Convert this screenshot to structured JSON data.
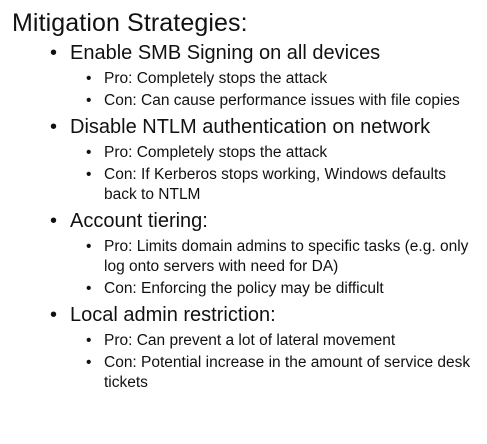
{
  "title": "Mitigation Strategies:",
  "bullet_glyph": "•",
  "strategies": [
    {
      "label": "Enable SMB Signing on all devices",
      "points": [
        "Pro: Completely stops the attack",
        "Con: Can cause performance issues with file copies"
      ]
    },
    {
      "label": "Disable NTLM authentication on network",
      "points": [
        "Pro: Completely stops the attack",
        "Con: If Kerberos stops working, Windows defaults back to NTLM"
      ]
    },
    {
      "label": "Account tiering:",
      "points": [
        "Pro: Limits domain admins to specific tasks (e.g. only log onto servers with need for DA)",
        "Con: Enforcing the policy may be difficult"
      ]
    },
    {
      "label": "Local admin restriction:",
      "points": [
        "Pro: Can prevent a lot of lateral movement",
        "Con: Potential increase in the amount of service desk tickets"
      ]
    }
  ]
}
